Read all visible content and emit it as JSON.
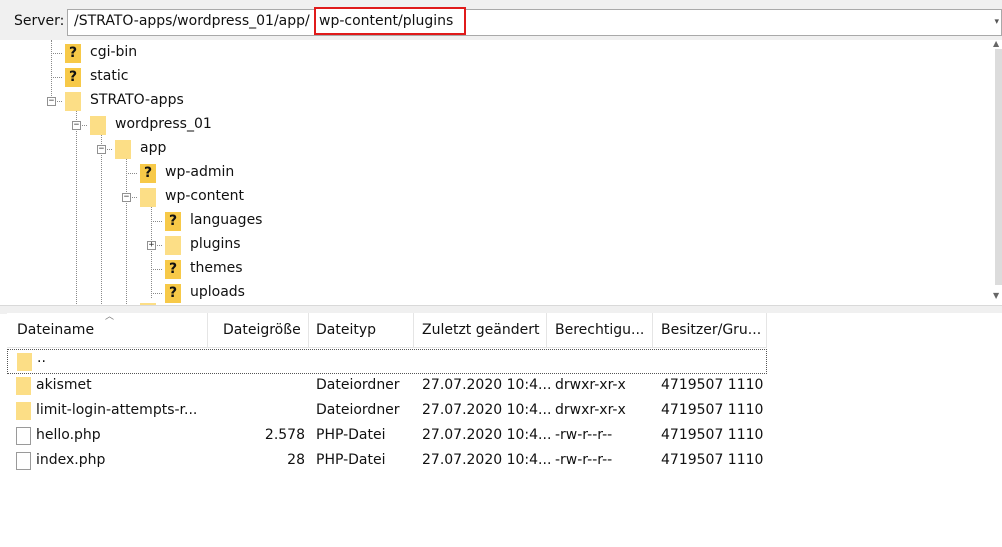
{
  "server": {
    "label": "Server:",
    "path_prefix": "/STRATO-apps/wordpress_01/app/",
    "path_highlight": "wp-content/plugins"
  },
  "tree": {
    "nodes": [
      {
        "name": "cgi-bin",
        "icon": "unknown-icon"
      },
      {
        "name": "static",
        "icon": "unknown-icon"
      },
      {
        "name": "STRATO-apps",
        "icon": "folder-icon"
      },
      {
        "name": "wordpress_01",
        "icon": "folder-icon"
      },
      {
        "name": "app",
        "icon": "folder-icon"
      },
      {
        "name": "wp-admin",
        "icon": "unknown-icon"
      },
      {
        "name": "wp-content",
        "icon": "folder-icon"
      },
      {
        "name": "languages",
        "icon": "unknown-icon"
      },
      {
        "name": "plugins",
        "icon": "folder-icon"
      },
      {
        "name": "themes",
        "icon": "unknown-icon"
      },
      {
        "name": "uploads",
        "icon": "unknown-icon"
      }
    ],
    "expander_open": "−",
    "expander_closed": "+",
    "unknown_glyph": "?"
  },
  "list": {
    "columns": [
      "Dateiname",
      "Dateigröße",
      "Dateityp",
      "Zuletzt geändert",
      "Berechtigu...",
      "Besitzer/Gru..."
    ],
    "rows": [
      {
        "name": "..",
        "size": "",
        "type": "",
        "modified": "",
        "perms": "",
        "owner": "",
        "icon": "folder-icon"
      },
      {
        "name": "akismet",
        "size": "",
        "type": "Dateiordner",
        "modified": "27.07.2020 10:4...",
        "perms": "drwxr-xr-x",
        "owner": "4719507 1110",
        "icon": "folder-icon"
      },
      {
        "name": "limit-login-attempts-r...",
        "size": "",
        "type": "Dateiordner",
        "modified": "27.07.2020 10:4...",
        "perms": "drwxr-xr-x",
        "owner": "4719507 1110",
        "icon": "folder-icon"
      },
      {
        "name": "hello.php",
        "size": "2.578",
        "type": "PHP-Datei",
        "modified": "27.07.2020 10:4...",
        "perms": "-rw-r--r--",
        "owner": "4719507 1110",
        "icon": "page-icon"
      },
      {
        "name": "index.php",
        "size": "28",
        "type": "PHP-Datei",
        "modified": "27.07.2020 10:4...",
        "perms": "-rw-r--r--",
        "owner": "4719507 1110",
        "icon": "page-icon"
      }
    ]
  },
  "colors": {
    "highlight_border": "#e01b1b",
    "folder": "#fcde86",
    "unknown": "#f7c948"
  }
}
